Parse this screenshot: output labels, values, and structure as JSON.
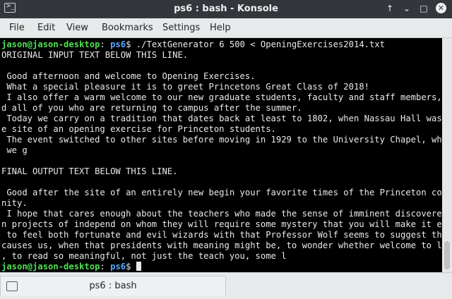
{
  "window": {
    "title": "ps6 : bash - Konsole",
    "buttons": {
      "keep_above": "↑",
      "minimize": "⌄",
      "maximize": "□",
      "close": "✕"
    }
  },
  "menu": [
    "File",
    "Edit",
    "View",
    "Bookmarks",
    "Settings",
    "Help"
  ],
  "terminal": {
    "prompt": {
      "user_host": "jason@jason-desktop",
      "path": "ps6",
      "symbol": "$"
    },
    "command": " ./TextGenerator 6 500 < OpeningExercises2014.txt",
    "output": [
      "ORIGINAL INPUT TEXT BELOW THIS LINE.",
      "",
      " Good afternoon and welcome to Opening Exercises.",
      " What a special pleasure it is to greet Princetons Great Class of 2018!",
      " I also offer a warm welcome to our new graduate students, faculty and staff members, an",
      "d all of you who are returning to campus after the summer.",
      " Today we carry on a tradition that dates back at least to 1802, when Nassau Hall was th",
      "e site of an opening exercise for Princeton students.",
      " The event switched to other sites before moving in 1929 to the University Chapel, where",
      " we g",
      "",
      "FINAL OUTPUT TEXT BELOW THIS LINE.",
      "",
      " Good after the site of an entirely new begin your favorite times of the Princeton commu",
      "nity.",
      " I hope that cares enough about the teachers who made the sense of imminent discovered i",
      "n projects of independ on whom they will require some mystery that you will make it easy",
      " to feel both fortunate and evil wizards with that Professor Wolf seems to suggest that",
      "causes us, when that presidents with meaning might be, to wonder whether welcome to live",
      ", to read so meaningful, not just the teach you, some l"
    ]
  },
  "tab": {
    "label": "ps6 : bash"
  },
  "colors": {
    "prompt_user": "#50e050",
    "prompt_path": "#55a8ff",
    "terminal_bg": "#000000"
  }
}
